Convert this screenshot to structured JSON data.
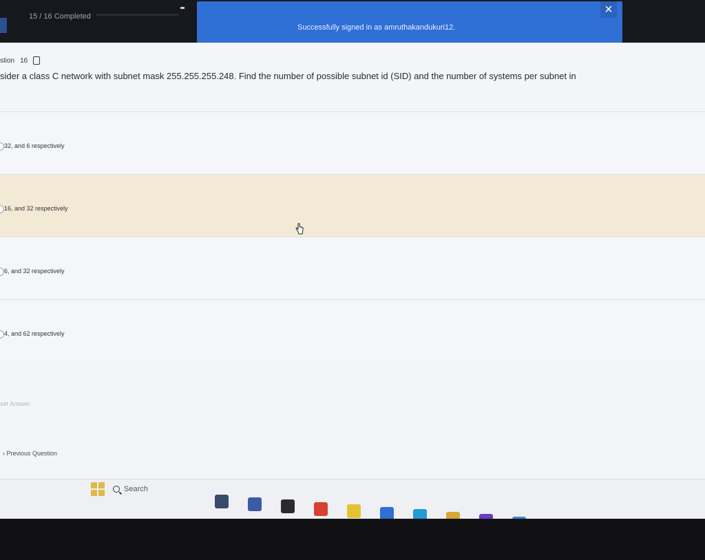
{
  "header": {
    "progress": "15 / 16 Completed"
  },
  "toast": {
    "message": "Successfully signed in as amruthakandukuri12.",
    "close": "×"
  },
  "question": {
    "label": "stion",
    "number": "16",
    "text": "sider a class C network with subnet mask 255.255.255.248. Find the number of possible subnet id (SID) and the number of systems per subnet in"
  },
  "options": [
    {
      "label": "32, and 6 respectively",
      "selected": false
    },
    {
      "label": "16, and 32 respectively",
      "selected": true
    },
    {
      "label": "6, and 32 respectively",
      "selected": false
    },
    {
      "label": "4, and 62 respectively",
      "selected": false
    }
  ],
  "actions": {
    "reset": "set Answer",
    "previous": "‹ Previous Question"
  },
  "taskbar": {
    "search_label": "Search",
    "apps": [
      {
        "icon": "person-app-icon",
        "color": "#3a4a6a"
      },
      {
        "icon": "chat-app-icon",
        "color": "#3b5aa8"
      },
      {
        "icon": "files-app-icon",
        "color": "#2b2b2b"
      },
      {
        "icon": "camera-app-icon",
        "color": "#d8412f"
      },
      {
        "icon": "notes-app-icon",
        "color": "#e4c233"
      },
      {
        "icon": "explorer-app-icon",
        "color": "#2f6fd6"
      },
      {
        "icon": "edge-browser-icon",
        "color": "#1f9bd7"
      },
      {
        "icon": "store-app-icon",
        "color": "#d9a735"
      },
      {
        "icon": "shield-app-icon",
        "color": "#6a3cc4"
      },
      {
        "icon": "weather-app-icon",
        "color": "#3a86e0"
      },
      {
        "icon": "paint-app-icon",
        "color": "#4a8f3d"
      },
      {
        "icon": "terminal-app-icon",
        "color": "#2c3e6e"
      },
      {
        "icon": "pycharm-app-icon",
        "color": "#111111"
      },
      {
        "icon": "chrome-browser-icon",
        "color": "#e8a12f"
      }
    ]
  }
}
